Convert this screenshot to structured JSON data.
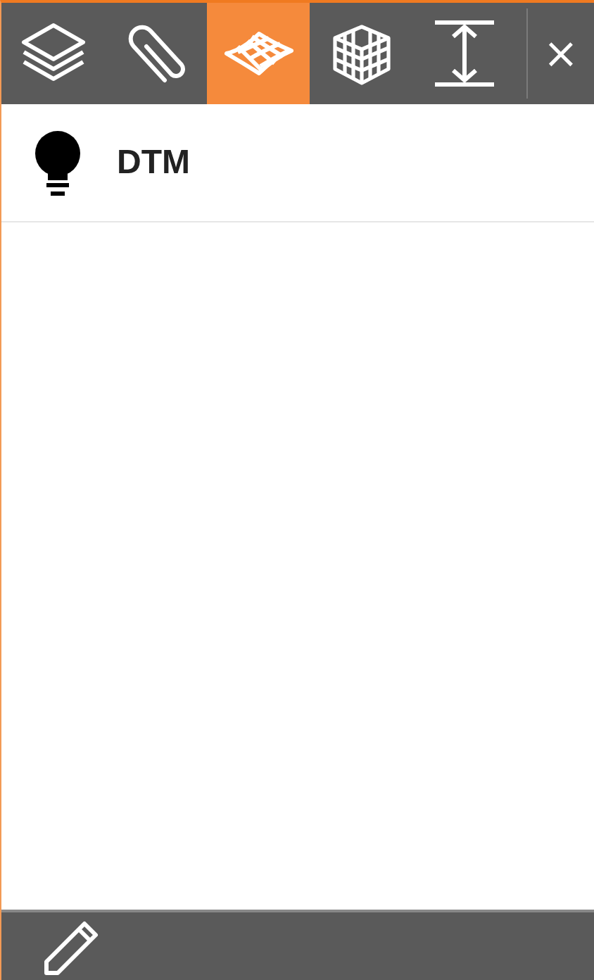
{
  "tabs": [
    {
      "kind": "layers",
      "selected": false
    },
    {
      "kind": "paperclip",
      "selected": false
    },
    {
      "kind": "surface",
      "selected": true
    },
    {
      "kind": "grid-cube",
      "selected": false
    },
    {
      "kind": "height",
      "selected": false
    }
  ],
  "close": "×",
  "items": [
    {
      "label": "DTM"
    }
  ]
}
